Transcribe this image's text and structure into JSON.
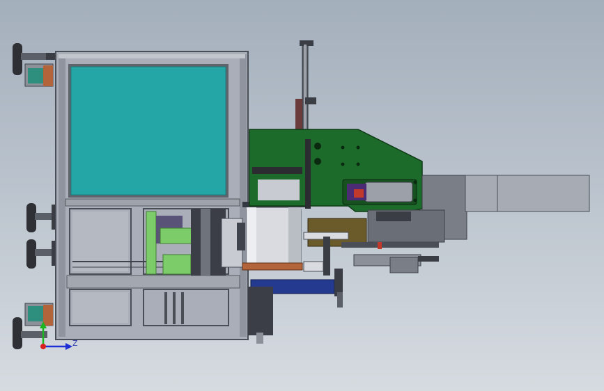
{
  "triad": {
    "z_label": "Z",
    "x_color": "#1e2fd6",
    "y_color": "#19b61f",
    "origin_color": "#d9211f"
  },
  "colors": {
    "frame": "#a9aeb8",
    "frame_dark": "#4a4e57",
    "window_panel": "#23a6a5",
    "green_housing": "#1d6b2a",
    "blue_rail": "#243a8f",
    "olive_block": "#6b5a2a",
    "light_green": "#7dcc6a",
    "roller": "#d9dbe0",
    "copper": "#b3643a"
  },
  "components": [
    "frame-cabinet",
    "window-panel",
    "lower-bays",
    "casters",
    "green-housing",
    "vertical-arm",
    "output-chute",
    "roller",
    "blue-rail"
  ]
}
